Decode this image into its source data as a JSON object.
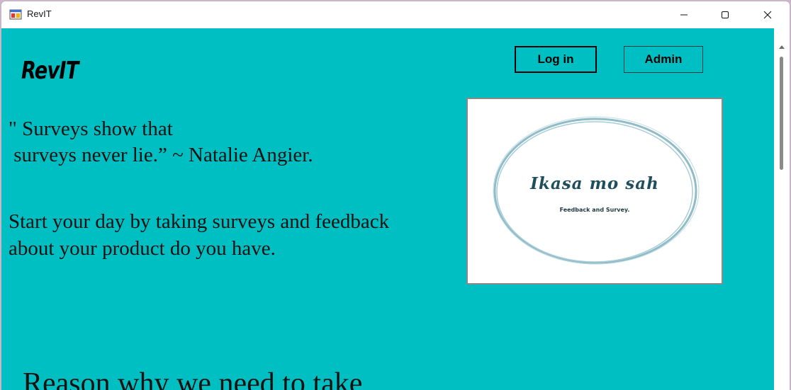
{
  "window": {
    "title": "RevIT"
  },
  "header": {
    "brand": "RevIT",
    "login_label": "Log in",
    "admin_label": "Admin"
  },
  "content": {
    "quote_line1": "\" Surveys show that",
    "quote_line2": " surveys never lie.” ~ Natalie Angier.",
    "intro_line1": "Start your day by taking surveys and feedback",
    "intro_line2": "about your product do you have.",
    "reason_heading": "Reason why we need to take"
  },
  "logo": {
    "title": "Ikasa mo sah",
    "subtitle": "Feedback and Survey."
  },
  "colors": {
    "background": "#00bfc2",
    "logo_ring": "#8fbcc8",
    "logo_text": "#1f4f5c"
  },
  "icons": {
    "app": "app-window-icon",
    "minimize": "minimize-icon",
    "maximize": "maximize-icon",
    "close": "close-icon"
  }
}
